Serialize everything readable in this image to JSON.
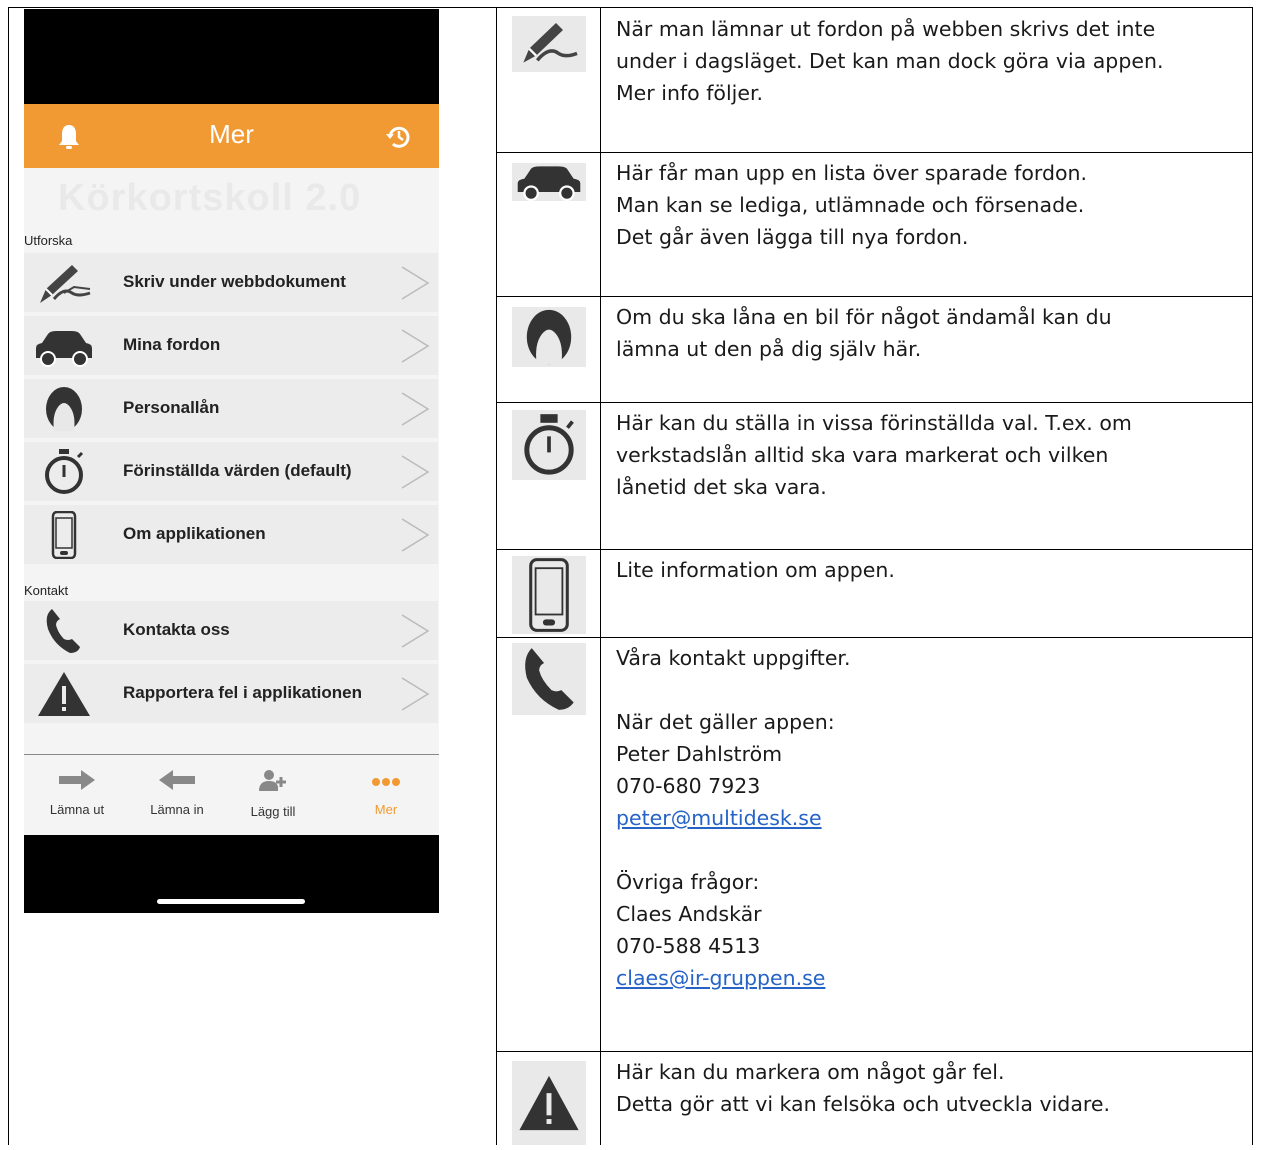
{
  "phone": {
    "nav_title": "Mer",
    "watermark": "Körkortskoll 2.0",
    "section_explore": "Utforska",
    "section_contact": "Kontakt",
    "menu_items": [
      {
        "label": "Skriv under webbdokument",
        "icon": "pen-icon"
      },
      {
        "label": "Mina fordon",
        "icon": "car-icon"
      },
      {
        "label": "Personallån",
        "icon": "person-icon"
      },
      {
        "label": "Förinställda värden (default)",
        "icon": "stopwatch-icon"
      },
      {
        "label": "Om applikationen",
        "icon": "phone-icon"
      }
    ],
    "contact_items": [
      {
        "label": "Kontakta oss",
        "icon": "call-icon"
      },
      {
        "label": "Rapportera fel i applikationen",
        "icon": "warning-icon"
      }
    ],
    "tabs": [
      {
        "label": "Lämna ut",
        "icon": "arrow-right-icon"
      },
      {
        "label": "Lämna in",
        "icon": "arrow-left-icon"
      },
      {
        "label": "Lägg till",
        "icon": "add-person-icon"
      },
      {
        "label": "Mer",
        "icon": "more-icon",
        "active": true
      }
    ],
    "accent": "#f19a33"
  },
  "descriptions": [
    {
      "icon": "pen-icon",
      "lines": [
        "När man lämnar ut fordon på webben skrivs det inte",
        "under i dagsläget. Det kan man dock göra via appen.",
        "Mer info följer."
      ]
    },
    {
      "icon": "car-icon",
      "lines": [
        "Här får man upp en lista över sparade fordon.",
        "Man kan se lediga, utlämnade och försenade.",
        "Det går även lägga till nya fordon."
      ]
    },
    {
      "icon": "person-icon",
      "lines": [
        "Om du ska låna en bil för något ändamål kan du",
        "lämna ut den på dig själv här."
      ]
    },
    {
      "icon": "stopwatch-icon",
      "lines": [
        "Här kan du ställa in vissa förinställda val. T.ex. om",
        "verkstadslån alltid ska vara markerat och vilken",
        "lånetid det ska vara."
      ]
    },
    {
      "icon": "phone-icon",
      "lines": [
        "Lite information om appen."
      ]
    },
    {
      "icon": "call-icon",
      "lines": [
        "Våra kontakt uppgifter."
      ]
    },
    {
      "icon": "warning-icon",
      "lines": [
        "Här kan du markera om något går fel.",
        "Detta gör att vi kan felsöka och utveckla vidare."
      ]
    }
  ],
  "contact": {
    "app_heading": "När det gäller appen:",
    "app_name": "Peter Dahlström",
    "app_phone": "070-680 7923",
    "app_email": "peter@multidesk.se",
    "other_heading": "Övriga frågor:",
    "other_name": "Claes Andskär",
    "other_phone": "070-588 4513",
    "other_email": "claes@ir-gruppen.se"
  },
  "link_color": "#2563c7"
}
